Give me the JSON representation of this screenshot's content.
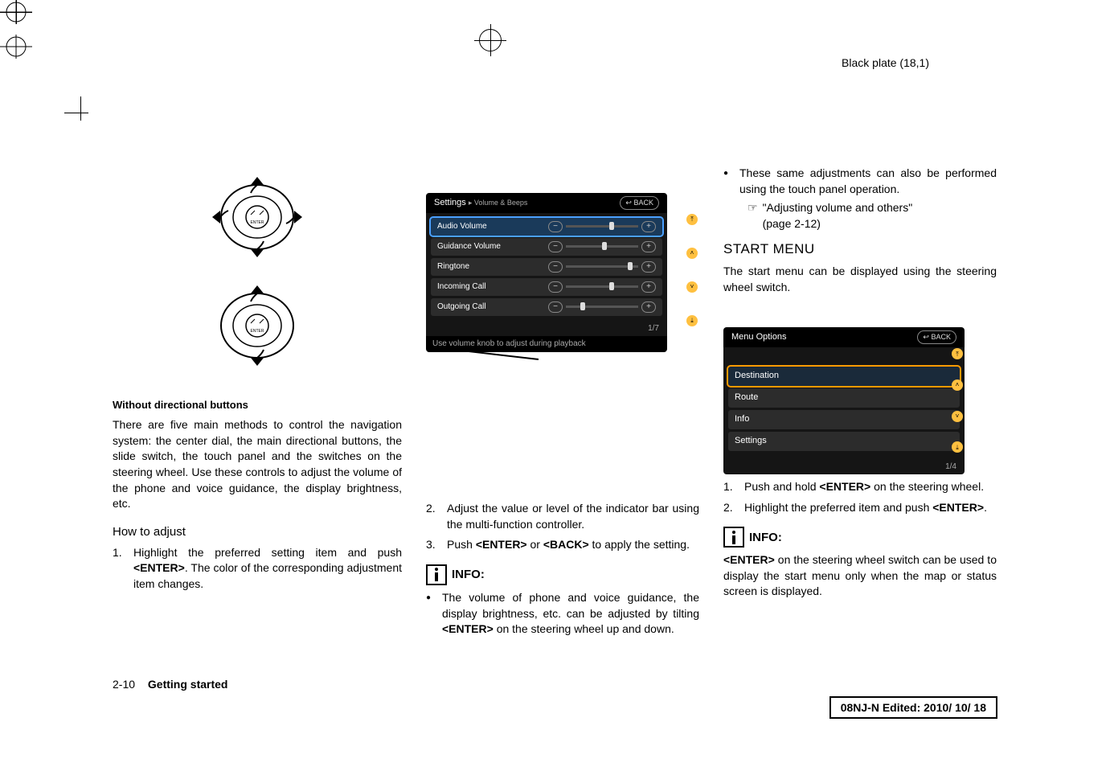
{
  "plate_label": "Black plate (18,1)",
  "dial_button_label": "ENTER",
  "settings_screen": {
    "title": "Settings",
    "breadcrumb": "Volume & Beeps",
    "back_icon": "↩",
    "back_label": "BACK",
    "rows": [
      {
        "label": "Audio Volume"
      },
      {
        "label": "Guidance Volume"
      },
      {
        "label": "Ringtone"
      },
      {
        "label": "Incoming Call"
      },
      {
        "label": "Outgoing Call"
      }
    ],
    "page_indicator": "1/7",
    "footer": "Use volume knob to adjust during playback"
  },
  "caption_without_buttons": "Without directional buttons",
  "intro_para": "There are five main methods to control the navigation system: the center dial, the main directional buttons, the slide switch, the touch panel and the switches on the steering wheel. Use these controls to adjust the volume of the phone and voice guidance, the display brightness, etc.",
  "how_to_adjust_title": "How to adjust",
  "steps": {
    "s1_a": "Highlight the preferred setting item and push ",
    "s1_enter": "<ENTER>",
    "s1_b": ". The color of the corresponding adjustment item changes.",
    "s2": "Adjust the value or level of the indicator bar using the multi-function controller.",
    "s3_a": "Push ",
    "s3_enter": "<ENTER>",
    "s3_or": " or ",
    "s3_back": "<BACK>",
    "s3_b": " to apply the setting."
  },
  "info_label": "INFO:",
  "info1_a": "The volume of phone and voice guidance, the display brightness, etc. can be adjusted by tilting ",
  "info1_enter": "<ENTER>",
  "info1_b": " on the steering wheel up and down.",
  "info0": "These same adjustments can also be performed using the touch panel operation.",
  "ref_text": "\"Adjusting volume and others\"",
  "ref_page": "(page 2-12)",
  "start_menu_title": "START MENU",
  "start_menu_para": "The start menu can be displayed using the steering wheel switch.",
  "menu_screen": {
    "title": "Menu Options",
    "back_icon": "↩",
    "back_label": "BACK",
    "rows": [
      {
        "label": "Destination"
      },
      {
        "label": "Route"
      },
      {
        "label": "Info"
      },
      {
        "label": "Settings"
      }
    ],
    "page_indicator": "1/4"
  },
  "start_steps": {
    "s1_a": "Push and hold ",
    "s1_enter": "<ENTER>",
    "s1_b": " on the steering wheel.",
    "s2_a": "Highlight the preferred item and push ",
    "s2_enter": "<ENTER>",
    "s2_b": "."
  },
  "info2_a": "<ENTER>",
  "info2_b": " on the steering wheel switch can be used to display the start menu only when the map or status screen is displayed.",
  "footer": {
    "page": "2-10",
    "section": "Getting started"
  },
  "edit_box": "08NJ-N Edited:  2010/ 10/ 18"
}
